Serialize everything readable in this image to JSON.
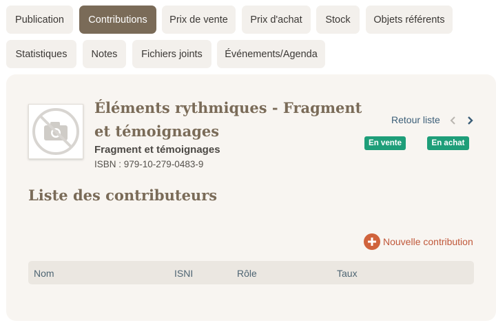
{
  "tabs": [
    {
      "label": "Publication",
      "active": false
    },
    {
      "label": "Contributions",
      "active": true
    },
    {
      "label": "Prix de vente",
      "active": false
    },
    {
      "label": "Prix d'achat",
      "active": false
    },
    {
      "label": "Stock",
      "active": false
    },
    {
      "label": "Objets référents",
      "active": false
    },
    {
      "label": "Statistiques",
      "active": false
    },
    {
      "label": "Notes",
      "active": false
    },
    {
      "label": "Fichiers joints",
      "active": false
    },
    {
      "label": "Événements/Agenda",
      "active": false
    }
  ],
  "book": {
    "title": "Éléments rythmiques - Fragment et témoignages",
    "subtitle": "Fragment et témoignages",
    "isbn": "ISBN : 979-10-279-0483-9",
    "thumbnail_icon": "no-photo-icon"
  },
  "nav": {
    "back_label": "Retour liste",
    "prev_icon": "chevron-left-icon",
    "next_icon": "chevron-right-icon"
  },
  "badges": {
    "sale": "En vente",
    "buy": "En achat"
  },
  "section": {
    "title": "Liste des contributeurs",
    "new_contribution_label": "Nouvelle contribution"
  },
  "table": {
    "columns": [
      "Nom",
      "ISNI",
      "Rôle",
      "Taux"
    ],
    "rows": []
  },
  "colors": {
    "accent_brown": "#7a6b58",
    "badge_green": "#1e9e79",
    "add_orange": "#d0633c",
    "link_blue": "#3b5e78"
  }
}
